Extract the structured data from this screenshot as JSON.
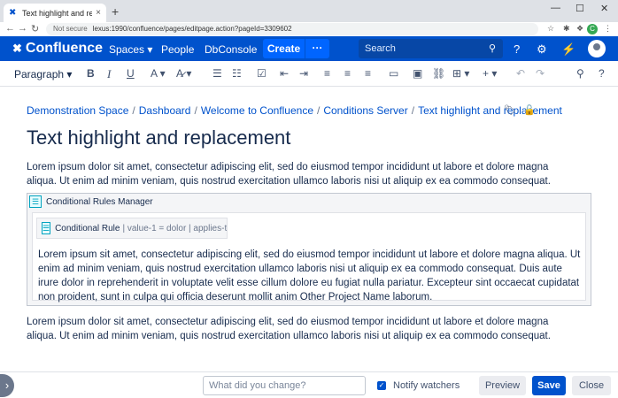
{
  "browser": {
    "tab_title": "Text highlight and replacement",
    "tab_close": "×",
    "new_tab": "+",
    "url_secure_label": "Not secure",
    "url": "lexus:1990/confluence/pages/editpage.action?pageId=3309602",
    "profile_initial": "C"
  },
  "nav": {
    "logo_text": "Confluence",
    "spaces": "Spaces",
    "people": "People",
    "dbconsole": "DbConsole",
    "create": "Create",
    "more": "···",
    "search_placeholder": "Search"
  },
  "toolbar": {
    "paragraph": "Paragraph"
  },
  "breadcrumb": [
    "Demonstration Space",
    "Dashboard",
    "Welcome to Confluence",
    "Conditions Server",
    "Text highlight and replacement"
  ],
  "breadcrumb_sep": "/",
  "page": {
    "title": "Text highlight and replacement",
    "para1": "Lorem ipsum dolor sit amet, consectetur adipiscing elit, sed do eiusmod tempor incididunt ut labore et dolore magna aliqua. Ut enim ad minim veniam, quis nostrud exercitation ullamco laboris nisi ut aliquip ex ea commodo consequat.",
    "para2": "Lorem ipsum dolor sit amet, consectetur adipiscing elit, sed do eiusmod tempor incididunt ut labore et dolore magna aliqua. Ut enim ad minim veniam, quis nostrud exercitation ullamco laboris nisi ut aliquip ex ea commodo consequat."
  },
  "macro": {
    "title": "Conditional Rules Manager",
    "rule_name": "Conditional Rule",
    "rule_meta": "| value-1 = dolor | applies-t...",
    "body": "Lorem ipsum sit amet, consectetur adipiscing elit, sed do eiusmod tempor incididunt ut labore et dolore magna aliqua. Ut enim ad minim veniam, quis nostrud exercitation ullamco laboris nisi ut aliquip ex ea commodo consequat. Duis aute irure dolor in reprehenderit in voluptate velit esse cillum dolore eu fugiat nulla pariatur. Excepteur sint occaecat cupidatat non proident, sunt in culpa qui officia deserunt mollit anim Other Project Name laborum."
  },
  "footer": {
    "comment_placeholder": "What did you change?",
    "notify_label": "Notify watchers",
    "notify_checked": true,
    "preview": "Preview",
    "save": "Save",
    "close": "Close"
  },
  "colors": {
    "brand": "#0052CC",
    "create_button": "#0065FF",
    "search_bg": "#0747A6"
  }
}
